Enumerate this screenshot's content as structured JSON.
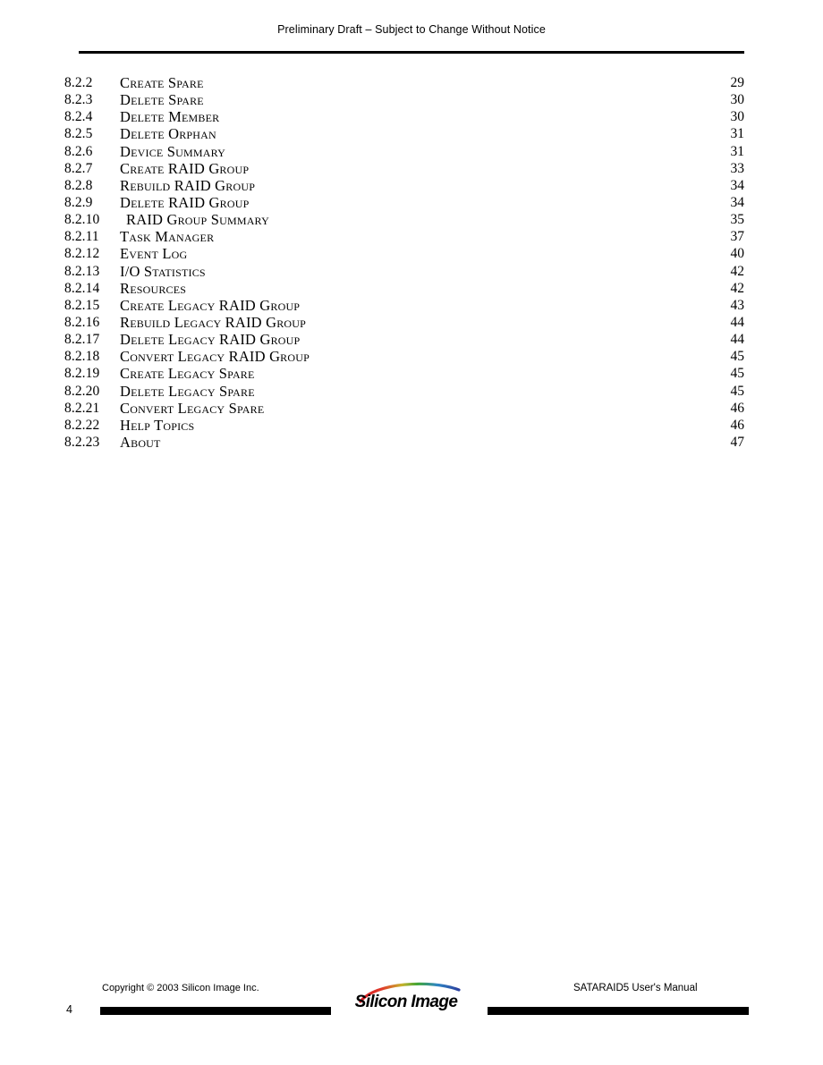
{
  "header": {
    "notice": "Preliminary Draft – Subject to Change Without Notice"
  },
  "toc": {
    "entries": [
      {
        "number": "8.2.2",
        "title": "Create Spare",
        "page": "29"
      },
      {
        "number": "8.2.3",
        "title": "Delete Spare",
        "page": "30"
      },
      {
        "number": "8.2.4",
        "title": "Delete Member",
        "page": "30"
      },
      {
        "number": "8.2.5",
        "title": "Delete Orphan",
        "page": "31"
      },
      {
        "number": "8.2.6",
        "title": "Device Summary",
        "page": "31"
      },
      {
        "number": "8.2.7",
        "title": "Create RAID Group",
        "page": "33"
      },
      {
        "number": "8.2.8",
        "title": "Rebuild RAID Group",
        "page": "34"
      },
      {
        "number": "8.2.9",
        "title": "Delete RAID Group",
        "page": "34"
      },
      {
        "number": "8.2.10",
        "title": "RAID Group Summary",
        "page": "35"
      },
      {
        "number": "8.2.11",
        "title": "Task Manager",
        "page": "37"
      },
      {
        "number": "8.2.12",
        "title": "Event Log",
        "page": "40"
      },
      {
        "number": "8.2.13",
        "title": "I/O Statistics",
        "page": "42"
      },
      {
        "number": "8.2.14",
        "title": "Resources",
        "page": "42"
      },
      {
        "number": "8.2.15",
        "title": "Create Legacy RAID Group",
        "page": "43"
      },
      {
        "number": "8.2.16",
        "title": "Rebuild Legacy RAID Group",
        "page": "44"
      },
      {
        "number": "8.2.17",
        "title": "Delete Legacy RAID Group",
        "page": "44"
      },
      {
        "number": "8.2.18",
        "title": "Convert Legacy RAID Group",
        "page": "45"
      },
      {
        "number": "8.2.19",
        "title": "Create Legacy Spare",
        "page": "45"
      },
      {
        "number": "8.2.20",
        "title": "Delete Legacy Spare",
        "page": "45"
      },
      {
        "number": "8.2.21",
        "title": "Convert Legacy Spare",
        "page": "46"
      },
      {
        "number": "8.2.22",
        "title": "Help Topics",
        "page": "46"
      },
      {
        "number": "8.2.23",
        "title": "About",
        "page": "47"
      }
    ]
  },
  "footer": {
    "copyright": "Copyright © 2003 Silicon Image Inc.",
    "manual_title": "SATARAID5 User's Manual",
    "page_number": "4",
    "logo_text": "Silicon Image",
    "logo_arc_colors": [
      "#d81f26",
      "#e8a12a",
      "#3fa535",
      "#1f72b8",
      "#2b3f9e"
    ]
  }
}
